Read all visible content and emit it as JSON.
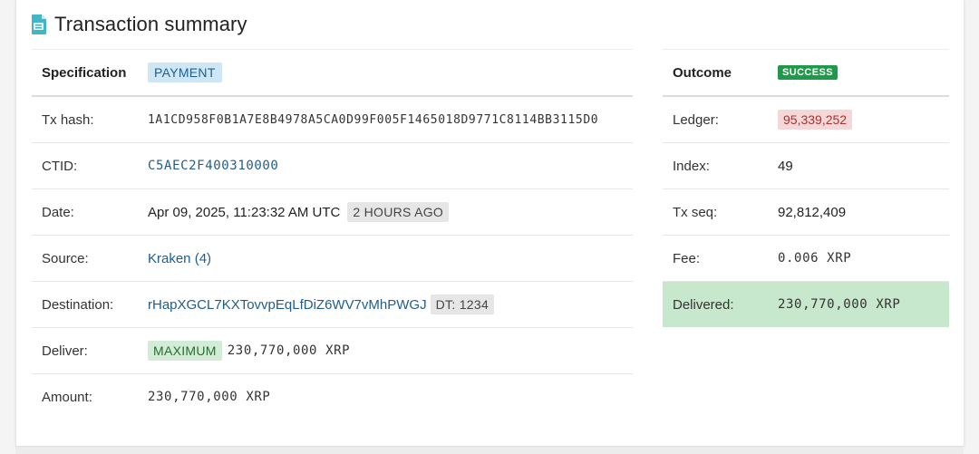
{
  "header": {
    "title": "Transaction summary",
    "icon": "document-icon"
  },
  "left": {
    "spec_label": "Specification",
    "spec_badge": "PAYMENT",
    "tx_hash": {
      "label": "Tx hash:",
      "value": "1A1CD958F0B1A7E8B4978A5CA0D99F005F1465018D9771C8114BB3115D0"
    },
    "ctid": {
      "label": "CTID:",
      "value": "C5AEC2F400310000"
    },
    "date": {
      "label": "Date:",
      "value": "Apr 09, 2025, 11:23:32 AM UTC",
      "ago": "2 HOURS AGO"
    },
    "source": {
      "label": "Source:",
      "value": "Kraken (4)"
    },
    "destination": {
      "label": "Destination:",
      "value": "rHapXGCL7KXTovvpEqLfDiZ6WV7vMhPWGJ",
      "tag": "DT: 1234"
    },
    "deliver": {
      "label": "Deliver:",
      "tag": "MAXIMUM",
      "value": "230,770,000 XRP"
    },
    "amount": {
      "label": "Amount:",
      "value": "230,770,000 XRP"
    }
  },
  "right": {
    "outcome_label": "Outcome",
    "outcome_badge": "SUCCESS",
    "ledger": {
      "label": "Ledger:",
      "value": "95,339,252"
    },
    "index": {
      "label": "Index:",
      "value": "49"
    },
    "tx_seq": {
      "label": "Tx seq:",
      "value": "92,812,409"
    },
    "fee": {
      "label": "Fee:",
      "value": "0.006 XRP"
    },
    "delivered": {
      "label": "Delivered:",
      "value": "230,770,000 XRP"
    }
  },
  "colors": {
    "link": "#1f5e8a",
    "success": "#1f9a4a",
    "delivered_bg": "#c7e8cc",
    "ledger_bg": "#f6d7d7",
    "payment_bg": "#cfe6f6"
  }
}
